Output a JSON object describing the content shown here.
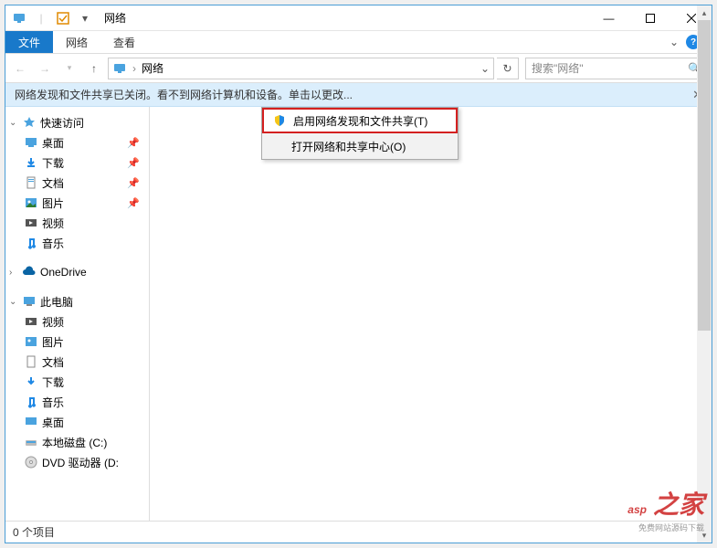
{
  "title": "网络",
  "ribbon": {
    "file": "文件",
    "tabs": [
      "网络",
      "查看"
    ]
  },
  "nav": {
    "breadcrumb": "网络"
  },
  "search": {
    "placeholder": "搜索\"网络\""
  },
  "infobar": {
    "message": "网络发现和文件共享已关闭。看不到网络计算机和设备。单击以更改..."
  },
  "context_menu": {
    "items": [
      "启用网络发现和文件共享(T)",
      "打开网络和共享中心(O)"
    ]
  },
  "sidebar": {
    "quick_access": "快速访问",
    "qa_items": [
      {
        "label": "桌面",
        "pinned": true
      },
      {
        "label": "下载",
        "pinned": true
      },
      {
        "label": "文档",
        "pinned": true
      },
      {
        "label": "图片",
        "pinned": true
      },
      {
        "label": "视频",
        "pinned": false
      },
      {
        "label": "音乐",
        "pinned": false
      }
    ],
    "onedrive": "OneDrive",
    "this_pc": "此电脑",
    "pc_items": [
      {
        "label": "视频"
      },
      {
        "label": "图片"
      },
      {
        "label": "文档"
      },
      {
        "label": "下载"
      },
      {
        "label": "音乐"
      },
      {
        "label": "桌面"
      },
      {
        "label": "本地磁盘 (C:)"
      },
      {
        "label": "DVD 驱动器 (D:"
      }
    ]
  },
  "statusbar": {
    "text": "0 个项目"
  },
  "watermark": "asp"
}
